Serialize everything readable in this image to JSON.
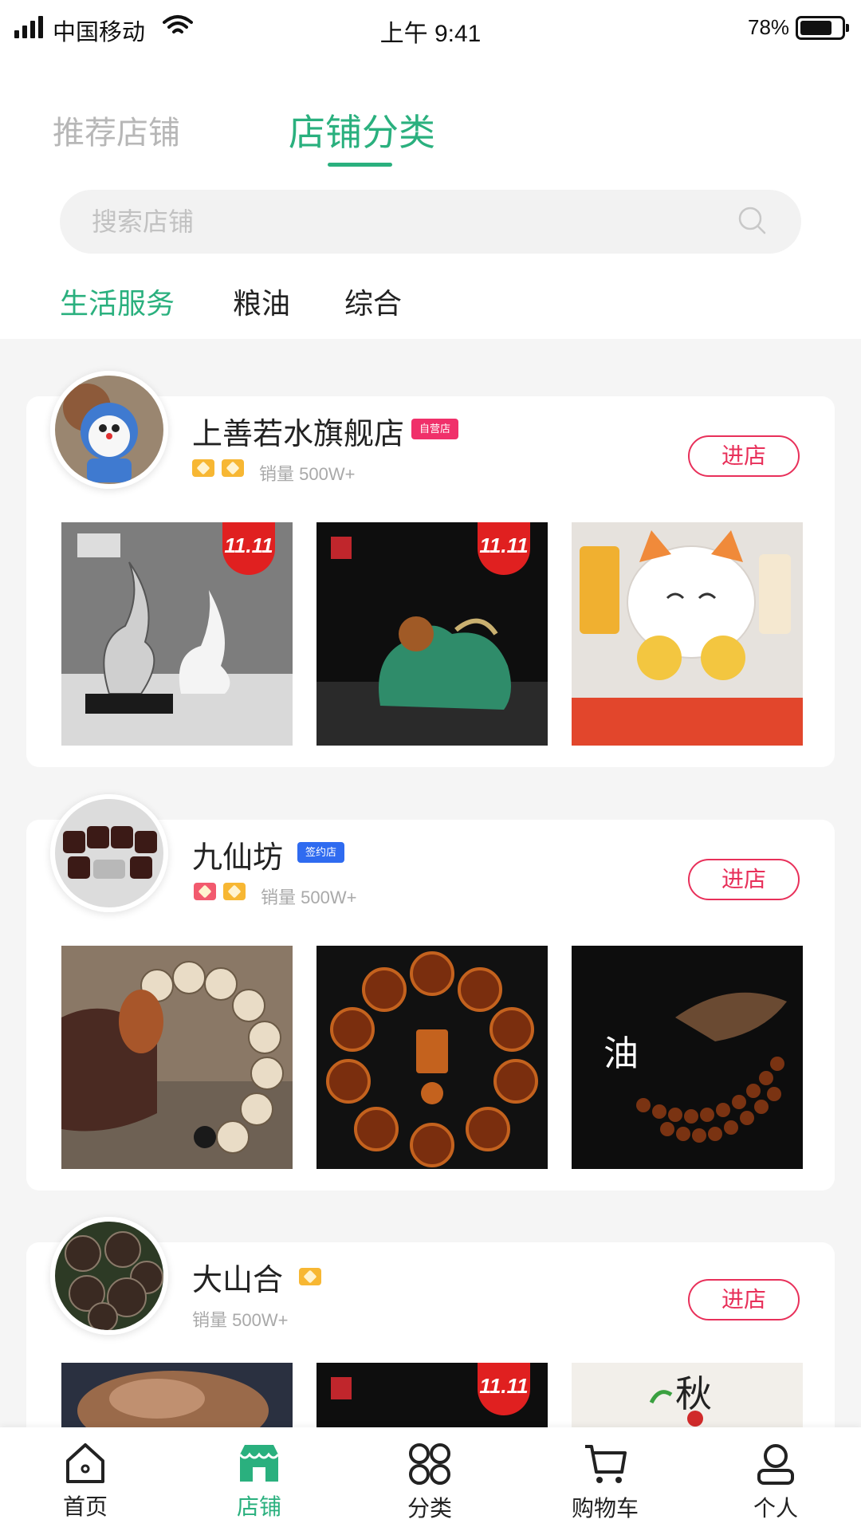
{
  "status_bar": {
    "carrier": "中国移动",
    "time": "上午 9:41",
    "battery": "78%",
    "battery_level": 0.78
  },
  "header": {
    "tabs": [
      {
        "label": "推荐店铺",
        "active": false
      },
      {
        "label": "店铺分类",
        "active": true
      }
    ],
    "search": {
      "placeholder": "搜索店铺",
      "value": ""
    },
    "categories": [
      {
        "label": "生活服务",
        "active": true
      },
      {
        "label": "粮油",
        "active": false
      },
      {
        "label": "综合",
        "active": false
      }
    ]
  },
  "stores": [
    {
      "name": "上善若水旗舰店",
      "tag": "自营店",
      "badges": [
        "gold-crown-icon",
        "gold-crown-icon"
      ],
      "sales": "销量 500W+",
      "button": "进店",
      "products": [
        {
          "image": "silver-flame-sculpture",
          "promo": "11.11"
        },
        {
          "image": "jade-pixiu-statue",
          "promo": "11.11"
        },
        {
          "image": "lucky-cat-figurine",
          "promo": ""
        }
      ]
    },
    {
      "name": "九仙坊",
      "tag": "签约店",
      "badges": [
        "red-crown-icon",
        "gold-crown-icon"
      ],
      "sales": "销量 500W+",
      "button": "进店",
      "products": [
        {
          "image": "bodhi-bead-bracelet",
          "promo": ""
        },
        {
          "image": "wood-bead-bracelet",
          "promo": ""
        },
        {
          "image": "agarwood-bead-necklace",
          "promo": ""
        }
      ]
    },
    {
      "name": "大山合",
      "tag": "",
      "badges": [
        "gold-crown-icon"
      ],
      "sales": "销量 500W+",
      "button": "进店",
      "products": [
        {
          "image": "dried-mushroom",
          "promo": ""
        },
        {
          "image": "dark-product",
          "promo": "11.11"
        },
        {
          "image": "autumn-poster",
          "promo": ""
        }
      ]
    }
  ],
  "bottom_nav": [
    {
      "label": "首页",
      "icon": "home-icon",
      "active": false
    },
    {
      "label": "店铺",
      "icon": "store-icon",
      "active": true
    },
    {
      "label": "分类",
      "icon": "category-icon",
      "active": false
    },
    {
      "label": "购物车",
      "icon": "cart-icon",
      "active": false
    },
    {
      "label": "个人",
      "icon": "user-icon",
      "active": false
    }
  ],
  "colors": {
    "accent": "#2ab07e",
    "enter": "#e8305a",
    "self_tag": "#f0306a",
    "signed_tag": "#2f6bf0"
  }
}
